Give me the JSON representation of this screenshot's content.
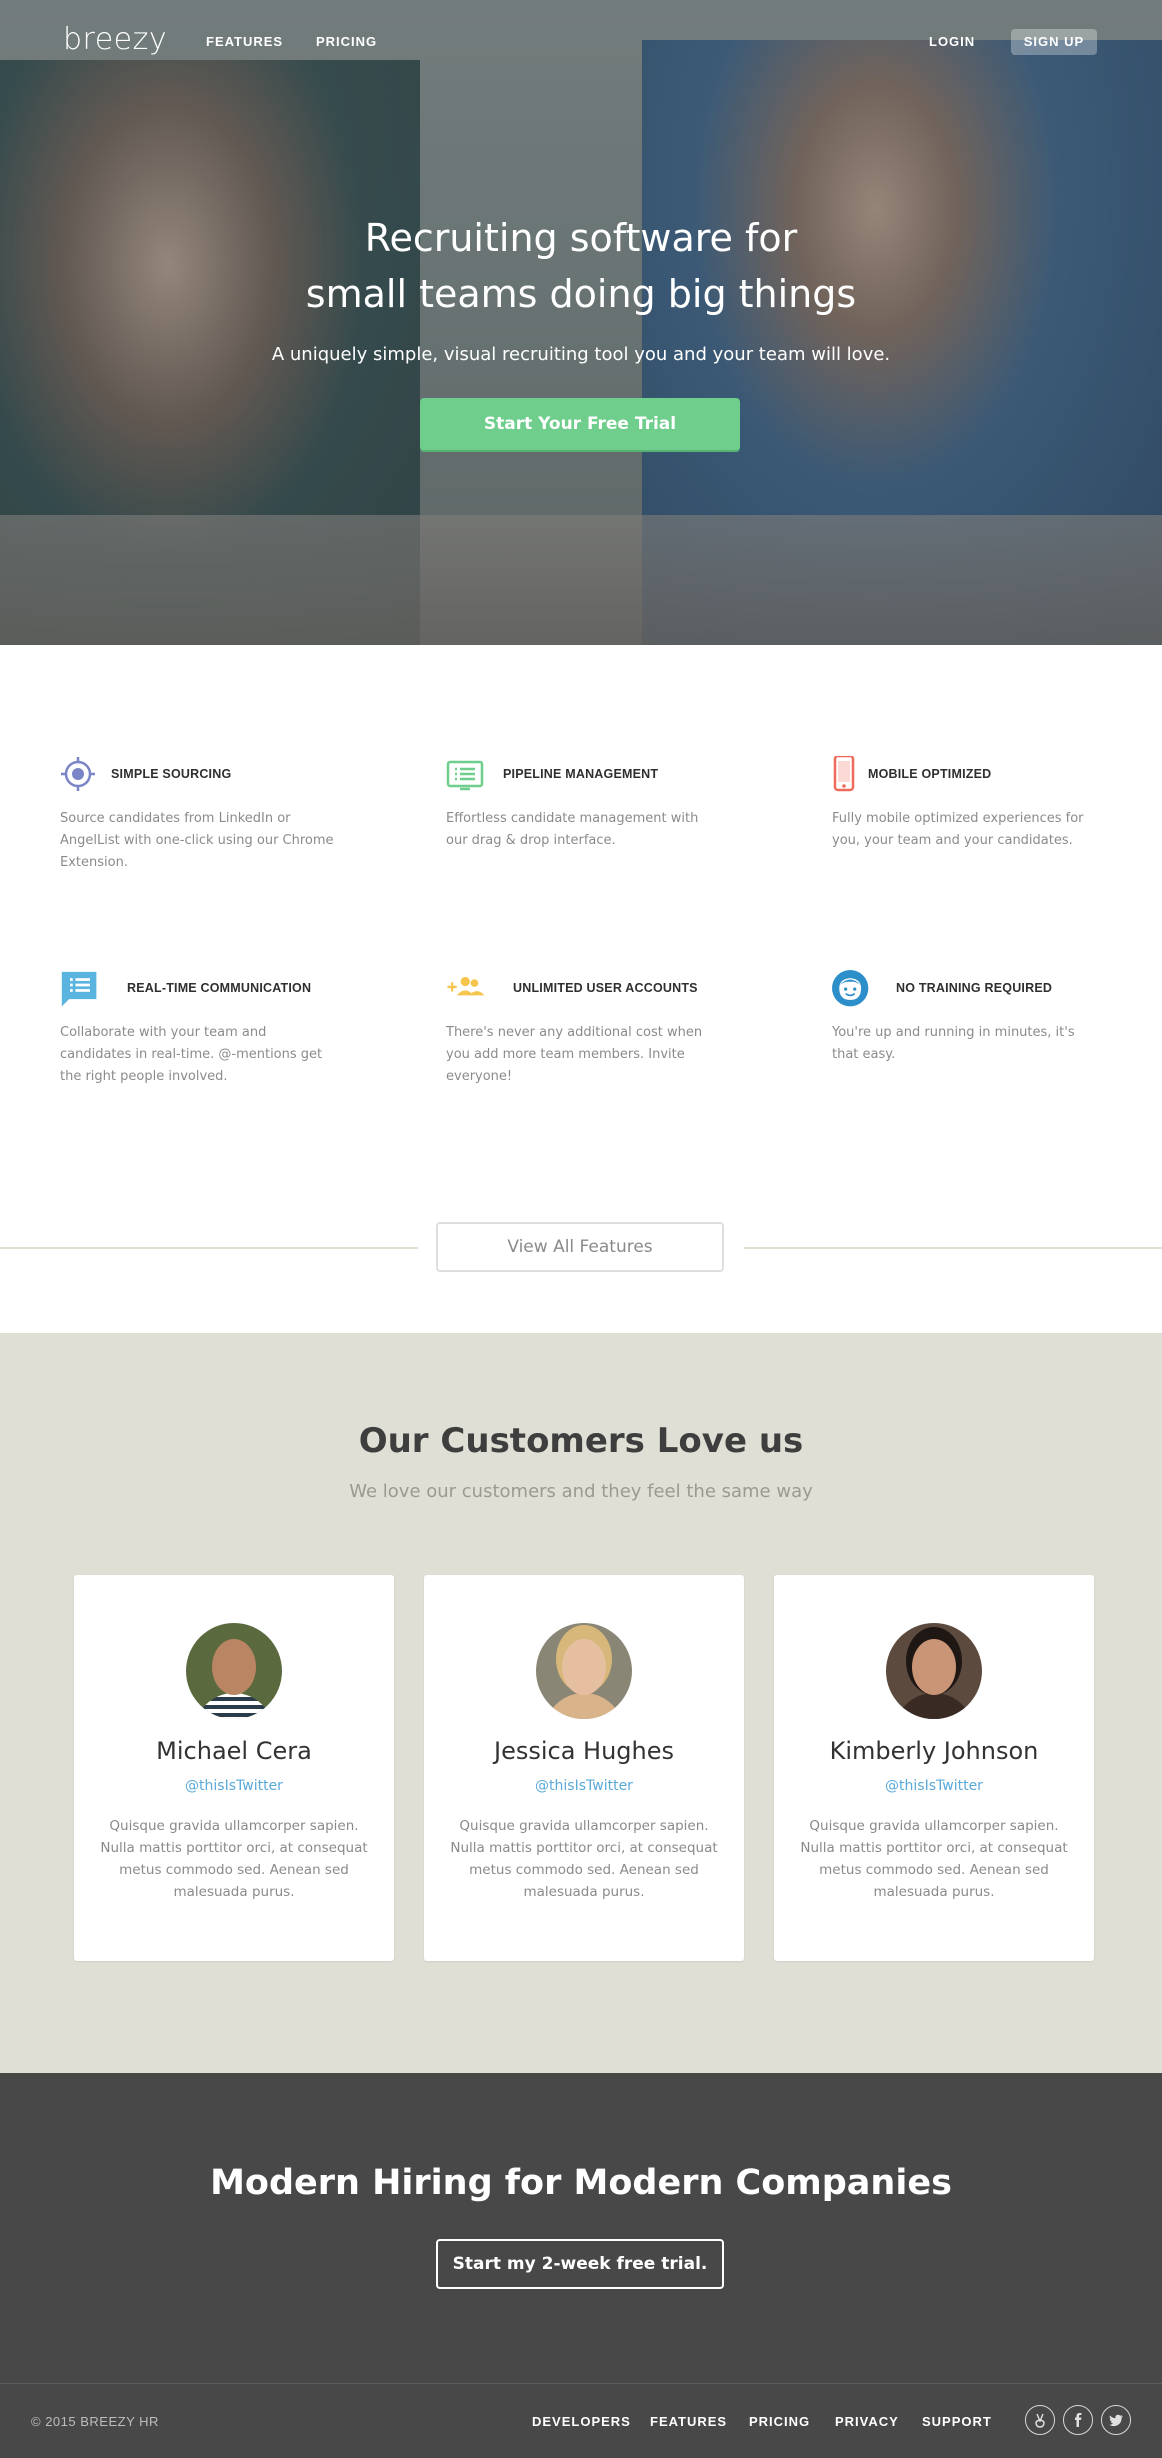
{
  "nav": {
    "logo": "breezy",
    "features": "FEATURES",
    "pricing": "PRICING",
    "login": "LOGIN",
    "signup": "SIGN UP"
  },
  "hero": {
    "title_line1": "Recruiting software for",
    "title_line2": "small teams doing big things",
    "subtitle": "A uniquely simple, visual recruiting tool you and your team will love.",
    "cta": "Start Your Free Trial"
  },
  "features": [
    {
      "title": "SIMPLE SOURCING",
      "desc": "Source candidates from LinkedIn or AngelList with one-click using our Chrome Extension.",
      "icon": "target-icon",
      "color": "#7b84c6"
    },
    {
      "title": "PIPELINE MANAGEMENT",
      "desc": "Effortless candidate management with our drag & drop interface.",
      "icon": "pipeline-board-icon",
      "color": "#6fce8c"
    },
    {
      "title": "MOBILE OPTIMIZED",
      "desc": "Fully mobile optimized experiences for you, your team and your candidates.",
      "icon": "mobile-phone-icon",
      "color": "#ef6a5a"
    },
    {
      "title": "REAL-TIME COMMUNICATION",
      "desc": "Collaborate with your team and candidates in real-time. @-mentions get the right people involved.",
      "icon": "chat-bubble-icon",
      "color": "#5ab4e0"
    },
    {
      "title": "UNLIMITED USER ACCOUNTS",
      "desc": "There's never any additional cost when you add more team members. Invite everyone!",
      "icon": "add-users-icon",
      "color": "#f5c54e"
    },
    {
      "title": "NO TRAINING REQUIRED",
      "desc": "You're up and running in minutes, it's that easy.",
      "icon": "smiley-face-icon",
      "color": "#2c8fc9"
    }
  ],
  "view_all": "View All Features",
  "customers": {
    "title": "Our Customers Love us",
    "subtitle": "We love our customers and they feel the same way",
    "items": [
      {
        "name": "Michael Cera",
        "handle": "@thisIsTwitter",
        "text": "Quisque gravida ullamcorper sapien. Nulla mattis porttitor orci, at consequat metus commodo sed. Aenean sed malesuada purus."
      },
      {
        "name": "Jessica Hughes",
        "handle": "@thisIsTwitter",
        "text": "Quisque gravida ullamcorper sapien. Nulla mattis porttitor orci, at consequat metus commodo sed. Aenean sed malesuada purus."
      },
      {
        "name": "Kimberly Johnson",
        "handle": "@thisIsTwitter",
        "text": "Quisque gravida ullamcorper sapien. Nulla mattis porttitor orci, at consequat metus commodo sed. Aenean sed malesuada purus."
      }
    ]
  },
  "cta": {
    "title": "Modern Hiring for Modern Companies",
    "button": "Start my 2-week free trial."
  },
  "footer": {
    "copyright": "© 2015 BREEZY HR",
    "links": [
      "DEVELOPERS",
      "FEATURES",
      "PRICING",
      "PRIVACY",
      "SUPPORT"
    ],
    "social": [
      "angellist-icon",
      "facebook-icon",
      "twitter-icon"
    ]
  },
  "colors": {
    "accent_green": "#6fce8c",
    "link_blue": "#5aa9d8",
    "customers_bg": "#e0dfd6",
    "dark_band": "#484848"
  }
}
